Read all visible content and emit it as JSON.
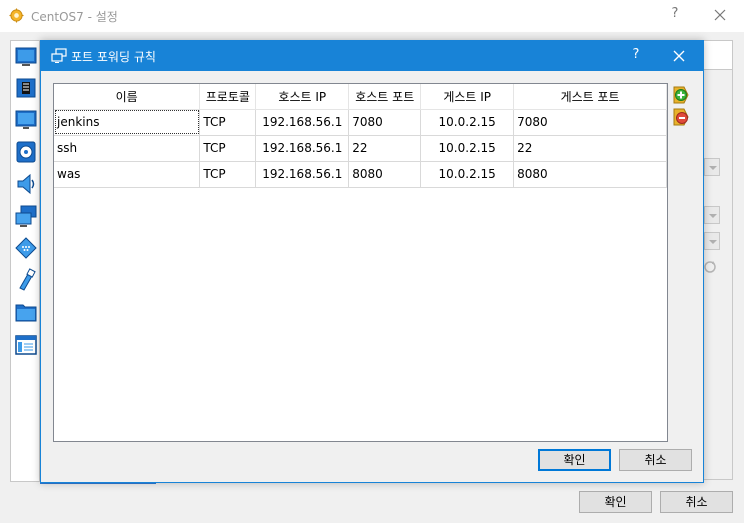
{
  "parent": {
    "title": "CentOS7 - 설정",
    "help_label": "?",
    "ok_label": "확인",
    "cancel_label": "취소",
    "sidebar_icons": [
      "display-icon",
      "storage-chip-icon",
      "system-monitor-icon",
      "optical-disc-icon",
      "audio-speaker-icon",
      "network-icon",
      "serial-port-icon",
      "usb-icon",
      "shared-folder-icon",
      "user-interface-icon"
    ]
  },
  "dialog": {
    "title": "포트 포워딩 규칙",
    "help_label": "?",
    "ok_label": "확인",
    "cancel_label": "취소",
    "columns": [
      "이름",
      "프로토콜",
      "호스트 IP",
      "호스트 포트",
      "게스트 IP",
      "게스트 포트"
    ],
    "rows": [
      {
        "name": "jenkins",
        "protocol": "TCP",
        "host_ip": "192.168.56.1",
        "host_port": "7080",
        "guest_ip": "10.0.2.15",
        "guest_port": "7080"
      },
      {
        "name": "ssh",
        "protocol": "TCP",
        "host_ip": "192.168.56.1",
        "host_port": "22",
        "guest_ip": "10.0.2.15",
        "guest_port": "22"
      },
      {
        "name": "was",
        "protocol": "TCP",
        "host_ip": "192.168.56.1",
        "host_port": "8080",
        "guest_ip": "10.0.2.15",
        "guest_port": "8080"
      }
    ],
    "add_rule_icon": "add-rule-icon",
    "remove_rule_icon": "remove-rule-icon"
  },
  "colors": {
    "accent": "#1883d7",
    "window_bg": "#f0f0f0"
  }
}
